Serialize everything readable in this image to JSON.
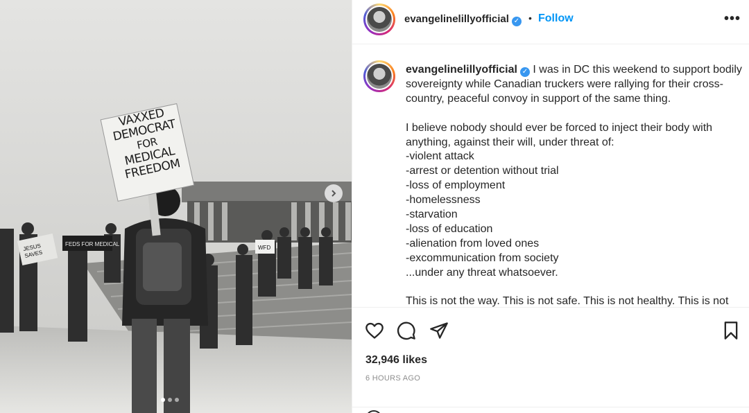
{
  "post": {
    "sign_text": [
      "VAXXED",
      "DEMOCRAT",
      "FOR",
      "MEDICAL",
      "FREEDOM"
    ]
  },
  "header": {
    "username": "evangelinelillyofficial",
    "separator": "•",
    "follow_label": "Follow",
    "more_label": "•••"
  },
  "caption": {
    "username": "evangelinelillyofficial",
    "paragraph1": "I was in DC this weekend to support bodily sovereignty while Canadian truckers were rallying for their cross-country, peaceful convoy in support of the same thing.",
    "paragraph2_intro": "I believe nobody should ever be forced to inject their body with anything, against their will, under threat of:",
    "list": [
      "-violent attack",
      "-arrest or detention without trial",
      "-loss of employment",
      "-homelessness",
      "-starvation",
      "-loss of education",
      "-alienation from loved ones",
      "-excommunication from society",
      "...under any threat whatsoever."
    ],
    "paragraph3": "This is not the way. This is not safe. This is not healthy. This is not"
  },
  "stats": {
    "likes": "32,946 likes",
    "time_ago": "6 HOURS AGO"
  },
  "icons": {
    "like": "heart-icon",
    "comment": "comment-icon",
    "share": "send-icon",
    "save": "bookmark-icon",
    "verified": "verified-badge-icon"
  },
  "colors": {
    "accent": "#0095f6",
    "verified": "#3897f0",
    "muted": "#8e8e8e"
  }
}
